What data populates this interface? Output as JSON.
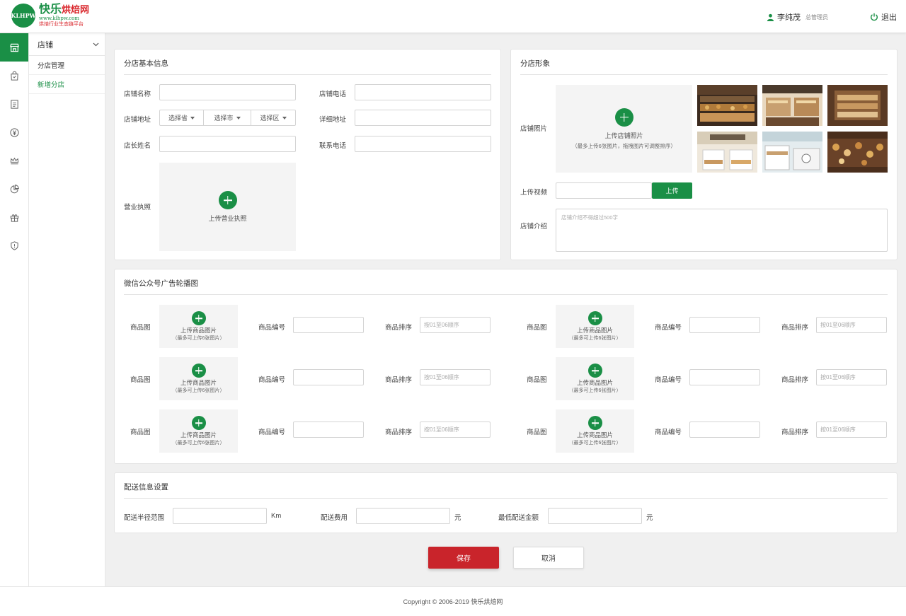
{
  "header": {
    "logo_badge": "KLHPW",
    "logo_name": "快乐",
    "logo_name_accent": "烘焙网",
    "logo_url": "www.klhpw.com",
    "logo_slogan": "烘焙行业生态链平台",
    "user_name": "李纯茂",
    "user_role": "总管理员",
    "logout_label": "退出"
  },
  "rail": {
    "icons": [
      "store-icon",
      "bag-icon",
      "document-icon",
      "yen-icon",
      "crown-icon",
      "pie-chart-icon",
      "gift-icon",
      "shield-icon"
    ],
    "active": "store-icon"
  },
  "submenu": {
    "title": "店铺",
    "items": [
      {
        "label": "分店管理",
        "active": false
      },
      {
        "label": "新增分店",
        "active": true
      }
    ]
  },
  "basic": {
    "title": "分店基本信息",
    "store_name_label": "店铺名称",
    "store_phone_label": "店铺电话",
    "address_label": "店铺地址",
    "province": "选择省",
    "city": "选择市",
    "district": "选择区",
    "detail_address_label": "详细地址",
    "manager_label": "店长姓名",
    "contact_label": "联系电话",
    "license_label": "营业执照",
    "license_upload": "上传营业执照"
  },
  "image": {
    "title": "分店形象",
    "photo_label": "店铺照片",
    "photo_upload": "上传店铺照片",
    "photo_note": "（最多上传6张图片，拖拽图片可调整排序）",
    "video_label": "上传视频",
    "video_button": "上传",
    "intro_label": "店铺介绍",
    "intro_placeholder": "店铺介绍不得超过500字"
  },
  "carousel": {
    "title": "微信公众号广告轮播图",
    "image_label": "商品图",
    "upload_text": "上传商品图片",
    "upload_note": "（最多可上传6张图片）",
    "code_label": "商品编号",
    "order_label": "商品排序",
    "order_placeholder": "按01至06顺序"
  },
  "delivery": {
    "title": "配送信息设置",
    "radius_label": "配送半径范围",
    "radius_unit": "Km",
    "fee_label": "配送费用",
    "fee_unit": "元",
    "min_label": "最低配送金额",
    "min_unit": "元"
  },
  "actions": {
    "save": "保存",
    "cancel": "取消"
  },
  "footer": {
    "copyright": "Copyright © 2006-2019 快乐烘焙网"
  },
  "colors": {
    "brand_green": "#1a8f46",
    "save_red": "#c9242b"
  }
}
